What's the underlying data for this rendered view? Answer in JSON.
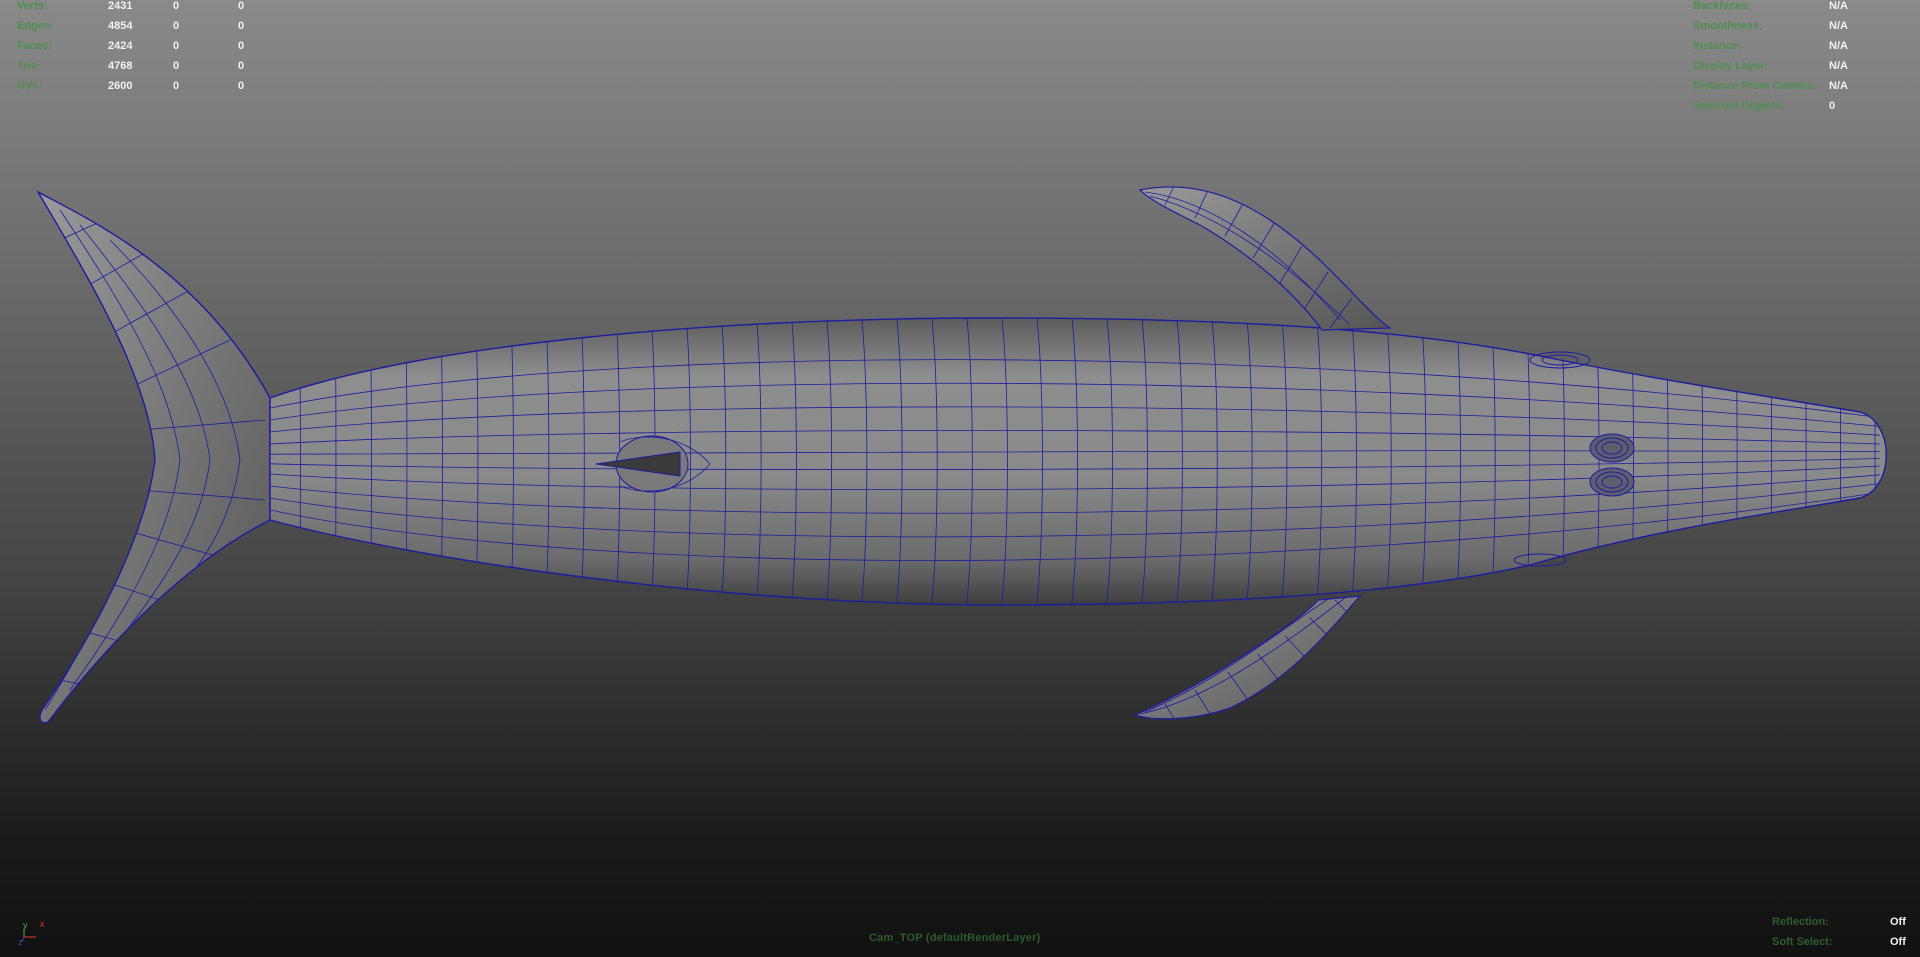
{
  "poly_count": {
    "rows": [
      {
        "label": "Verts:",
        "values": [
          "2431",
          "0",
          "0"
        ]
      },
      {
        "label": "Edges:",
        "values": [
          "4854",
          "0",
          "0"
        ]
      },
      {
        "label": "Faces:",
        "values": [
          "2424",
          "0",
          "0"
        ]
      },
      {
        "label": "Tris:",
        "values": [
          "4768",
          "0",
          "0"
        ]
      },
      {
        "label": "UVs:",
        "values": [
          "2600",
          "0",
          "0"
        ]
      }
    ]
  },
  "object_details": {
    "rows": [
      {
        "label": "Backfaces:",
        "value": "N/A"
      },
      {
        "label": "Smoothness:",
        "value": "N/A"
      },
      {
        "label": "Instance:",
        "value": "N/A"
      },
      {
        "label": "Display Layer:",
        "value": "N/A"
      },
      {
        "label": "Distance From Camera:",
        "value": "N/A"
      },
      {
        "label": "Selected Objects:",
        "value": "0"
      }
    ]
  },
  "display_details": {
    "rows": [
      {
        "label": "Reflection:",
        "value": "Off"
      },
      {
        "label": "Soft Select:",
        "value": "Off"
      }
    ]
  },
  "camera": {
    "label": "Cam_TOP (defaultRenderLayer)"
  },
  "axis_gizmo": {
    "y": "y",
    "x": "x",
    "z": "z",
    "y_color": "#4caf50",
    "x_color": "#e53935",
    "z_color": "#3949ab"
  },
  "colors": {
    "hud_label": "#4f8d50",
    "hud_value": "#f2f2f2",
    "wireframe": "#1c1ca0",
    "mesh_shade": "#8a8a8a"
  }
}
